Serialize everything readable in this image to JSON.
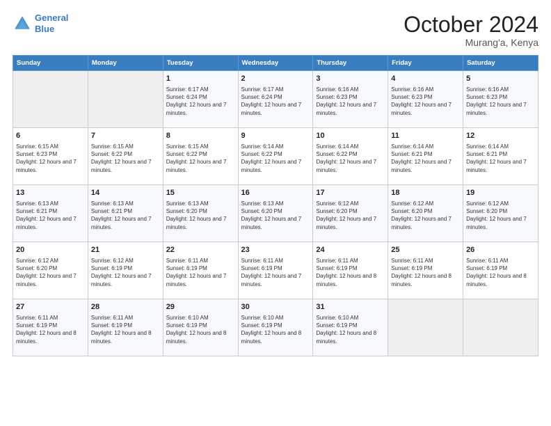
{
  "logo": {
    "line1": "General",
    "line2": "Blue"
  },
  "title": "October 2024",
  "location": "Murang'a, Kenya",
  "headers": [
    "Sunday",
    "Monday",
    "Tuesday",
    "Wednesday",
    "Thursday",
    "Friday",
    "Saturday"
  ],
  "weeks": [
    [
      {
        "day": "",
        "info": ""
      },
      {
        "day": "",
        "info": ""
      },
      {
        "day": "1",
        "info": "Sunrise: 6:17 AM\nSunset: 6:24 PM\nDaylight: 12 hours and 7 minutes."
      },
      {
        "day": "2",
        "info": "Sunrise: 6:17 AM\nSunset: 6:24 PM\nDaylight: 12 hours and 7 minutes."
      },
      {
        "day": "3",
        "info": "Sunrise: 6:16 AM\nSunset: 6:23 PM\nDaylight: 12 hours and 7 minutes."
      },
      {
        "day": "4",
        "info": "Sunrise: 6:16 AM\nSunset: 6:23 PM\nDaylight: 12 hours and 7 minutes."
      },
      {
        "day": "5",
        "info": "Sunrise: 6:16 AM\nSunset: 6:23 PM\nDaylight: 12 hours and 7 minutes."
      }
    ],
    [
      {
        "day": "6",
        "info": "Sunrise: 6:15 AM\nSunset: 6:23 PM\nDaylight: 12 hours and 7 minutes."
      },
      {
        "day": "7",
        "info": "Sunrise: 6:15 AM\nSunset: 6:22 PM\nDaylight: 12 hours and 7 minutes."
      },
      {
        "day": "8",
        "info": "Sunrise: 6:15 AM\nSunset: 6:22 PM\nDaylight: 12 hours and 7 minutes."
      },
      {
        "day": "9",
        "info": "Sunrise: 6:14 AM\nSunset: 6:22 PM\nDaylight: 12 hours and 7 minutes."
      },
      {
        "day": "10",
        "info": "Sunrise: 6:14 AM\nSunset: 6:22 PM\nDaylight: 12 hours and 7 minutes."
      },
      {
        "day": "11",
        "info": "Sunrise: 6:14 AM\nSunset: 6:21 PM\nDaylight: 12 hours and 7 minutes."
      },
      {
        "day": "12",
        "info": "Sunrise: 6:14 AM\nSunset: 6:21 PM\nDaylight: 12 hours and 7 minutes."
      }
    ],
    [
      {
        "day": "13",
        "info": "Sunrise: 6:13 AM\nSunset: 6:21 PM\nDaylight: 12 hours and 7 minutes."
      },
      {
        "day": "14",
        "info": "Sunrise: 6:13 AM\nSunset: 6:21 PM\nDaylight: 12 hours and 7 minutes."
      },
      {
        "day": "15",
        "info": "Sunrise: 6:13 AM\nSunset: 6:20 PM\nDaylight: 12 hours and 7 minutes."
      },
      {
        "day": "16",
        "info": "Sunrise: 6:13 AM\nSunset: 6:20 PM\nDaylight: 12 hours and 7 minutes."
      },
      {
        "day": "17",
        "info": "Sunrise: 6:12 AM\nSunset: 6:20 PM\nDaylight: 12 hours and 7 minutes."
      },
      {
        "day": "18",
        "info": "Sunrise: 6:12 AM\nSunset: 6:20 PM\nDaylight: 12 hours and 7 minutes."
      },
      {
        "day": "19",
        "info": "Sunrise: 6:12 AM\nSunset: 6:20 PM\nDaylight: 12 hours and 7 minutes."
      }
    ],
    [
      {
        "day": "20",
        "info": "Sunrise: 6:12 AM\nSunset: 6:20 PM\nDaylight: 12 hours and 7 minutes."
      },
      {
        "day": "21",
        "info": "Sunrise: 6:12 AM\nSunset: 6:19 PM\nDaylight: 12 hours and 7 minutes."
      },
      {
        "day": "22",
        "info": "Sunrise: 6:11 AM\nSunset: 6:19 PM\nDaylight: 12 hours and 7 minutes."
      },
      {
        "day": "23",
        "info": "Sunrise: 6:11 AM\nSunset: 6:19 PM\nDaylight: 12 hours and 7 minutes."
      },
      {
        "day": "24",
        "info": "Sunrise: 6:11 AM\nSunset: 6:19 PM\nDaylight: 12 hours and 8 minutes."
      },
      {
        "day": "25",
        "info": "Sunrise: 6:11 AM\nSunset: 6:19 PM\nDaylight: 12 hours and 8 minutes."
      },
      {
        "day": "26",
        "info": "Sunrise: 6:11 AM\nSunset: 6:19 PM\nDaylight: 12 hours and 8 minutes."
      }
    ],
    [
      {
        "day": "27",
        "info": "Sunrise: 6:11 AM\nSunset: 6:19 PM\nDaylight: 12 hours and 8 minutes."
      },
      {
        "day": "28",
        "info": "Sunrise: 6:11 AM\nSunset: 6:19 PM\nDaylight: 12 hours and 8 minutes."
      },
      {
        "day": "29",
        "info": "Sunrise: 6:10 AM\nSunset: 6:19 PM\nDaylight: 12 hours and 8 minutes."
      },
      {
        "day": "30",
        "info": "Sunrise: 6:10 AM\nSunset: 6:19 PM\nDaylight: 12 hours and 8 minutes."
      },
      {
        "day": "31",
        "info": "Sunrise: 6:10 AM\nSunset: 6:19 PM\nDaylight: 12 hours and 8 minutes."
      },
      {
        "day": "",
        "info": ""
      },
      {
        "day": "",
        "info": ""
      }
    ]
  ]
}
